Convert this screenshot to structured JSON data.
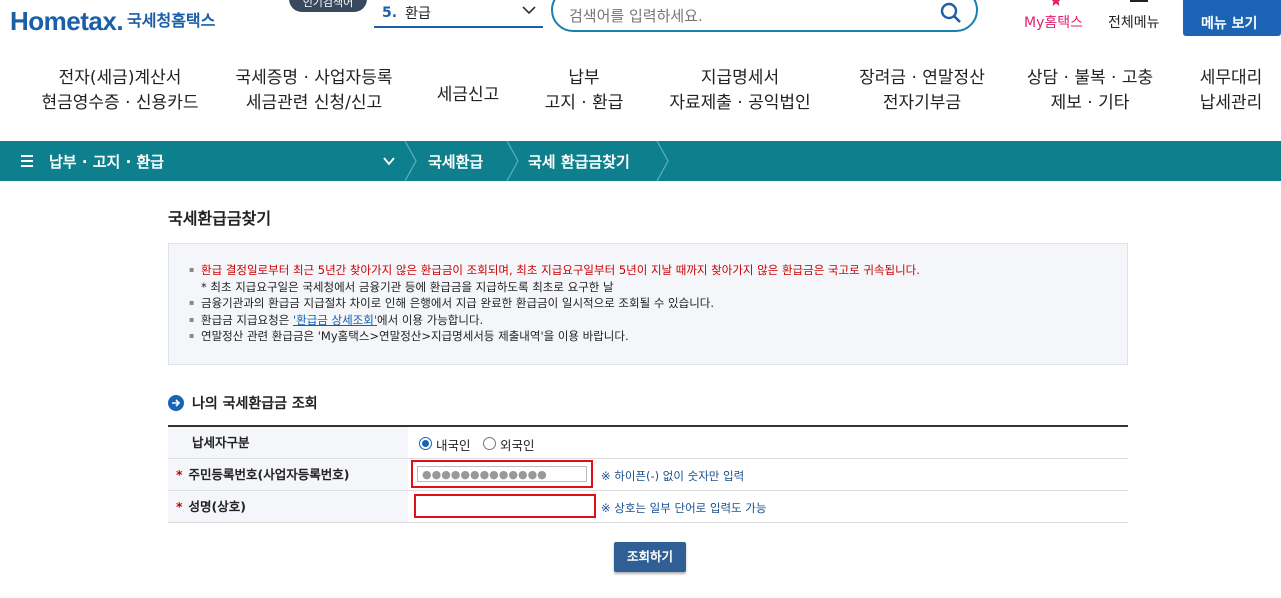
{
  "header": {
    "logo_en": "Hometax.",
    "logo_ko": "국세청홈택스",
    "pill_label": "인기검색어",
    "menu_select": {
      "number": "5.",
      "label": "환급"
    },
    "search_placeholder": "검색어를 입력하세요.",
    "my_hometax": "My홈택스",
    "all_menu": "전체메뉴",
    "menu_view": "메뉴 보기"
  },
  "gnb": [
    {
      "line1": "전자(세금)계산서",
      "line2": "현금영수증 · 신용카드"
    },
    {
      "line1": "국세증명 · 사업자등록",
      "line2": "세금관련 신청/신고"
    },
    {
      "line1": "세금신고",
      "line2": ""
    },
    {
      "line1": "납부",
      "line2": "고지 · 환급"
    },
    {
      "line1": "지급명세서",
      "line2": "자료제출 · 공익법인"
    },
    {
      "line1": "장려금 · 연말정산",
      "line2": "전자기부금"
    },
    {
      "line1": "상담 · 불복 · 고충",
      "line2": "제보 · 기타"
    },
    {
      "line1": "세무대리",
      "line2": "납세관리"
    }
  ],
  "location": {
    "level1": "납부 · 고지 · 환급",
    "level2": "국세환급",
    "level3": "국세 환급금찾기"
  },
  "page_title": "국세환급금찾기",
  "notice": {
    "line1": "환급 결정일로부터 최근 5년간 찾아가지 않은 환급금이 조회되며, 최초 지급요구일부터 5년이 지날 때까지 찾아가지 않은 환급금은 국고로 귀속됩니다.",
    "line1_sub": "* 최초 지급요구일은 국세청에서 금융기관 등에 환급금을 지급하도록 최초로 요구한 날",
    "line2": "금융기관과의 환급금 지급절차 차이로 인해 은행에서 지급 완료한 환급금이 일시적으로 조회될 수 있습니다.",
    "line3_pre": "환급금 지급요청은 ",
    "line3_link": "'환급금 상세조회'",
    "line3_post": "에서 이용 가능합니다.",
    "line4": "연말정산 관련 환급금은 'My홈택스>연말정산>지급명세서등 제출내역'을 이용 바랍니다."
  },
  "section_title": "나의 국세환급금 조회",
  "form": {
    "taxpayer_type_label": "납세자구분",
    "radio_domestic": "내국인",
    "radio_foreign": "외국인",
    "selected": "내국인",
    "id_label": "주민등록번호(사업자등록번호)",
    "id_value": "●●●●●●●●●●●●●",
    "id_hint": "※ 하이픈(-) 없이 숫자만 입력",
    "name_label": "성명(상호)",
    "name_value": "",
    "name_hint": "※ 상호는 일부 단어로 입력도 가능",
    "required_mark": "*"
  },
  "submit_label": "조회하기",
  "colors": {
    "brand_blue": "#1b5fa8",
    "teal_bar": "#0e7f8c",
    "notice_red": "#cc0000",
    "highlight_red": "#e0101a",
    "button": "#2f5f94"
  }
}
